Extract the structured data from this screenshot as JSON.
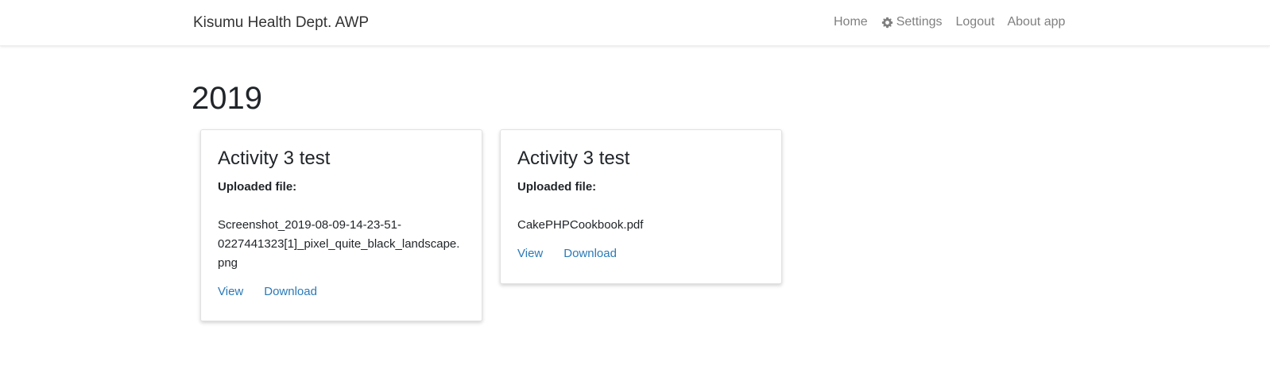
{
  "navbar": {
    "brand": "Kisumu Health Dept. AWP",
    "links": {
      "home": "Home",
      "settings": "Settings",
      "logout": "Logout",
      "about": "About app"
    },
    "settings_icon": "gear-icon",
    "link_color": "#808080"
  },
  "main": {
    "year_heading": "2019",
    "cards": [
      {
        "title": "Activity 3 test",
        "label": "Uploaded file:",
        "file_line_1": "Screenshot_2019-08-09-14-23-51-",
        "file_line_2": "0227441323[1]_pixel_quite_black_landscape.",
        "file_line_3": "png",
        "view": "View",
        "download": "Download"
      },
      {
        "title": "Activity 3 test",
        "label": "Uploaded file:",
        "file_line_1": "CakePHPCookbook.pdf",
        "view": "View",
        "download": "Download"
      }
    ],
    "link_color": "#2a7ab8"
  }
}
